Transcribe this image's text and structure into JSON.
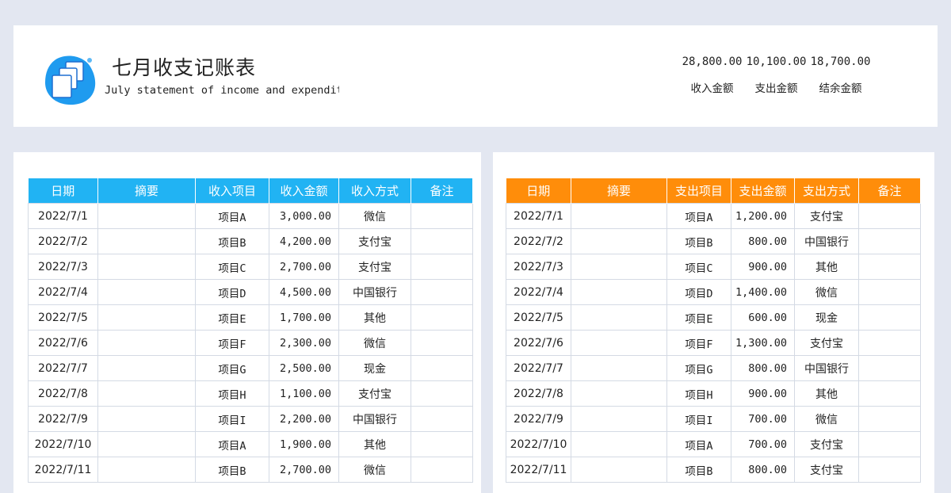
{
  "header": {
    "title": "七月收支记账表",
    "subtitle": "July statement of income and expenditure"
  },
  "summary": {
    "values": [
      "28,800.00",
      "10,100.00",
      "18,700.00"
    ],
    "labels": [
      "收入金额",
      "支出金额",
      "结余金额"
    ]
  },
  "colors": {
    "income_header": "#21b3f3",
    "expense_header": "#ff8d0a",
    "logo": "#1f9bef"
  },
  "income": {
    "columns": [
      "日期",
      "摘要",
      "收入项目",
      "收入金额",
      "收入方式",
      "备注"
    ],
    "rows": [
      [
        "2022/7/1",
        "",
        "项目A",
        "3,000.00",
        "微信",
        ""
      ],
      [
        "2022/7/2",
        "",
        "项目B",
        "4,200.00",
        "支付宝",
        ""
      ],
      [
        "2022/7/3",
        "",
        "项目C",
        "2,700.00",
        "支付宝",
        ""
      ],
      [
        "2022/7/4",
        "",
        "项目D",
        "4,500.00",
        "中国银行",
        ""
      ],
      [
        "2022/7/5",
        "",
        "项目E",
        "1,700.00",
        "其他",
        ""
      ],
      [
        "2022/7/6",
        "",
        "项目F",
        "2,300.00",
        "微信",
        ""
      ],
      [
        "2022/7/7",
        "",
        "项目G",
        "2,500.00",
        "现金",
        ""
      ],
      [
        "2022/7/8",
        "",
        "项目H",
        "1,100.00",
        "支付宝",
        ""
      ],
      [
        "2022/7/9",
        "",
        "项目I",
        "2,200.00",
        "中国银行",
        ""
      ],
      [
        "2022/7/10",
        "",
        "项目A",
        "1,900.00",
        "其他",
        ""
      ],
      [
        "2022/7/11",
        "",
        "项目B",
        "2,700.00",
        "微信",
        ""
      ]
    ]
  },
  "expense": {
    "columns": [
      "日期",
      "摘要",
      "支出项目",
      "支出金额",
      "支出方式",
      "备注"
    ],
    "rows": [
      [
        "2022/7/1",
        "",
        "项目A",
        "1,200.00",
        "支付宝",
        ""
      ],
      [
        "2022/7/2",
        "",
        "项目B",
        "800.00",
        "中国银行",
        ""
      ],
      [
        "2022/7/3",
        "",
        "项目C",
        "900.00",
        "其他",
        ""
      ],
      [
        "2022/7/4",
        "",
        "项目D",
        "1,400.00",
        "微信",
        ""
      ],
      [
        "2022/7/5",
        "",
        "项目E",
        "600.00",
        "现金",
        ""
      ],
      [
        "2022/7/6",
        "",
        "项目F",
        "1,300.00",
        "支付宝",
        ""
      ],
      [
        "2022/7/7",
        "",
        "项目G",
        "800.00",
        "中国银行",
        ""
      ],
      [
        "2022/7/8",
        "",
        "项目H",
        "900.00",
        "其他",
        ""
      ],
      [
        "2022/7/9",
        "",
        "项目I",
        "700.00",
        "微信",
        ""
      ],
      [
        "2022/7/10",
        "",
        "项目A",
        "700.00",
        "支付宝",
        ""
      ],
      [
        "2022/7/11",
        "",
        "项目B",
        "800.00",
        "支付宝",
        ""
      ]
    ]
  }
}
